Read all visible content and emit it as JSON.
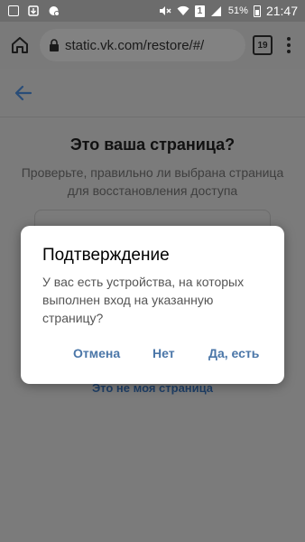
{
  "status_bar": {
    "battery_percent": "51%",
    "time": "21:47",
    "sim_label": "1"
  },
  "browser": {
    "url": "static.vk.com/restore/#/",
    "tab_count": "19"
  },
  "page": {
    "title": "Это ваша страница?",
    "subtitle": "Проверьте, правильно ли выбрана страница для восстановления доступа",
    "not_mine_link": "Это не моя страница"
  },
  "dialog": {
    "title": "Подтверждение",
    "message": "У вас есть устройства, на которых выполнен вход на указанную страницу?",
    "cancel_label": "Отмена",
    "no_label": "Нет",
    "yes_label": "Да, есть"
  },
  "colors": {
    "accent": "#4a76a8",
    "scrim": "#7b7b7b"
  }
}
